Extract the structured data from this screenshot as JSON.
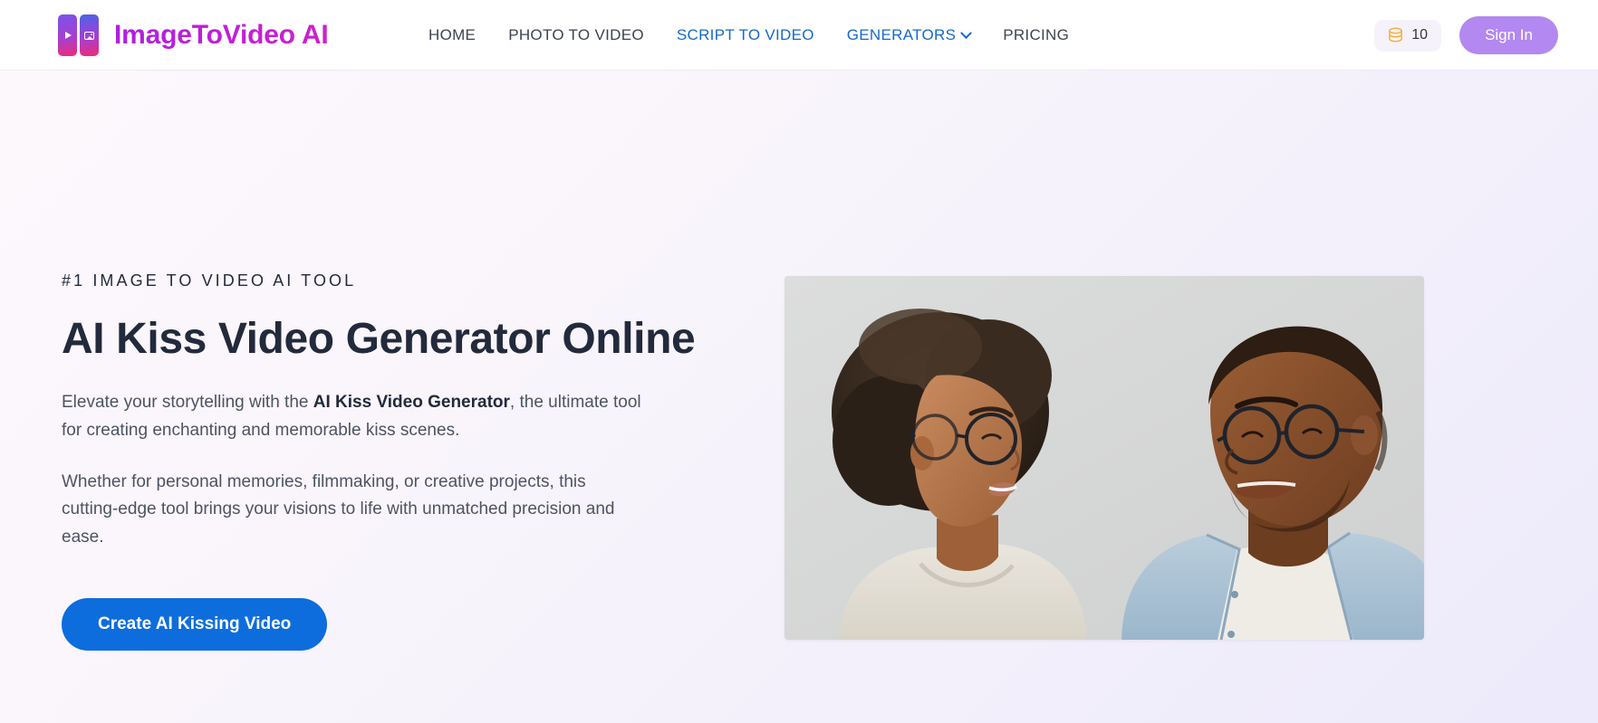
{
  "header": {
    "brand": {
      "name": "ImageToVideo AI",
      "logo_icon_left": "play-icon",
      "logo_icon_right": "image-icon"
    },
    "nav": [
      {
        "label": "HOME",
        "accent": false,
        "has_chevron": false
      },
      {
        "label": "PHOTO TO VIDEO",
        "accent": false,
        "has_chevron": false
      },
      {
        "label": "SCRIPT TO VIDEO",
        "accent": true,
        "has_chevron": false
      },
      {
        "label": "GENERATORS",
        "accent": true,
        "has_chevron": true
      },
      {
        "label": "PRICING",
        "accent": false,
        "has_chevron": false
      }
    ],
    "credits": {
      "icon": "coin-stack-icon",
      "count": "10"
    },
    "sign_in_label": "Sign In"
  },
  "hero": {
    "eyebrow": "#1 IMAGE TO VIDEO AI TOOL",
    "title": "AI Kiss Video Generator Online",
    "paragraph1_before": "Elevate your storytelling with the ",
    "paragraph1_bold": "AI Kiss Video Generator",
    "paragraph1_after": ", the ultimate tool for creating enchanting and memorable kiss scenes.",
    "paragraph2": "Whether for personal memories, filmmaking, or creative projects, this cutting-edge tool brings your visions to life with unmatched precision and ease.",
    "cta_label": "Create AI Kissing Video",
    "image_alt": "Smiling woman with afro hair and glasses next to smiling man in denim shirt and glasses, looking at each other on a grey background"
  },
  "colors": {
    "brand_magenta": "#c21fd6",
    "nav_accent_blue": "#1769c9",
    "nav_text": "#3d4450",
    "cta_blue": "#0d6ddc",
    "signin_purple": "#b388f0",
    "credits_badge_bg": "#f6f2fb",
    "coin_gold": "#f0b23c",
    "heading_navy": "#222a3c",
    "body_text": "#4d5462",
    "hero_bg_start": "#fdf8fc",
    "hero_bg_end": "#eceafb"
  }
}
